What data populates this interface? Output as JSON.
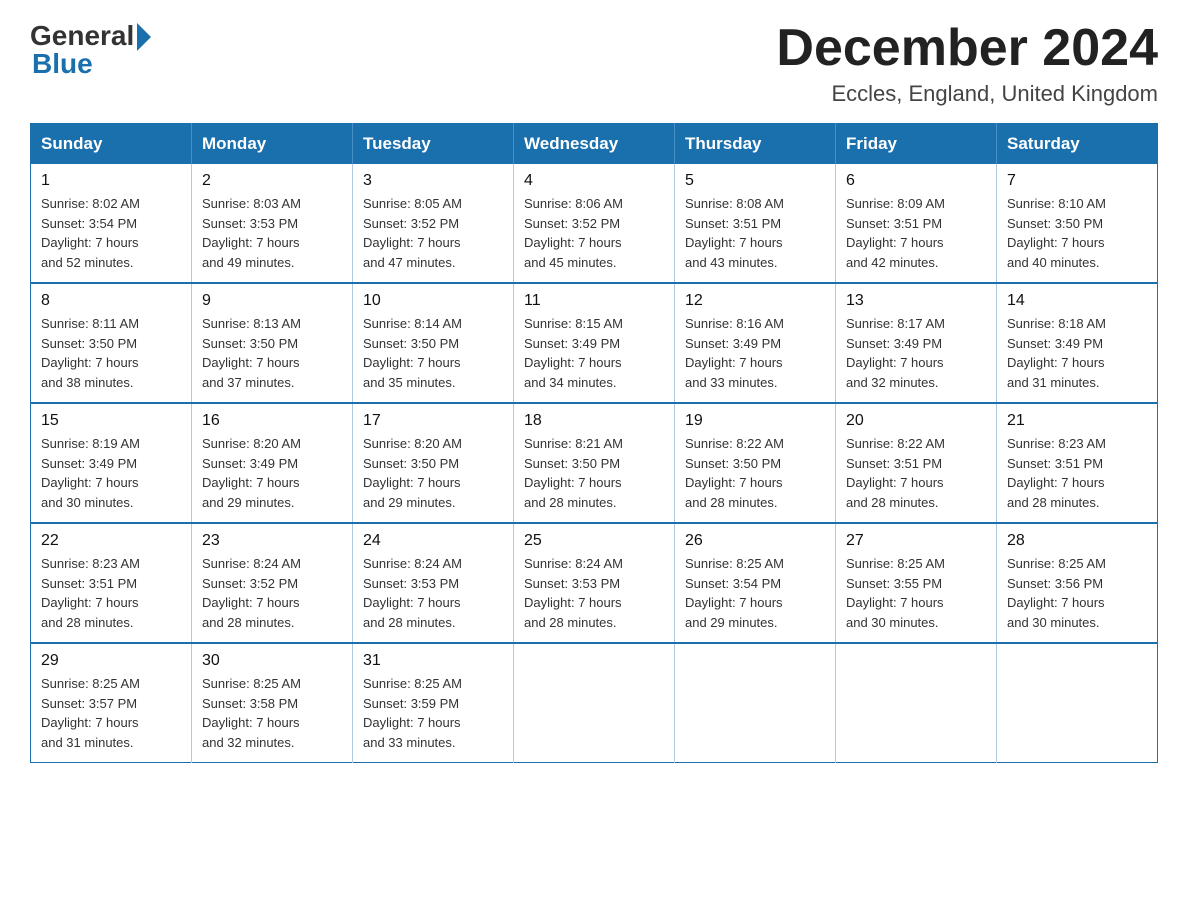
{
  "logo": {
    "general": "General",
    "blue": "Blue"
  },
  "title": "December 2024",
  "location": "Eccles, England, United Kingdom",
  "days_of_week": [
    "Sunday",
    "Monday",
    "Tuesday",
    "Wednesday",
    "Thursday",
    "Friday",
    "Saturday"
  ],
  "weeks": [
    [
      {
        "day": "1",
        "sunrise": "8:02 AM",
        "sunset": "3:54 PM",
        "daylight": "7 hours and 52 minutes."
      },
      {
        "day": "2",
        "sunrise": "8:03 AM",
        "sunset": "3:53 PM",
        "daylight": "7 hours and 49 minutes."
      },
      {
        "day": "3",
        "sunrise": "8:05 AM",
        "sunset": "3:52 PM",
        "daylight": "7 hours and 47 minutes."
      },
      {
        "day": "4",
        "sunrise": "8:06 AM",
        "sunset": "3:52 PM",
        "daylight": "7 hours and 45 minutes."
      },
      {
        "day": "5",
        "sunrise": "8:08 AM",
        "sunset": "3:51 PM",
        "daylight": "7 hours and 43 minutes."
      },
      {
        "day": "6",
        "sunrise": "8:09 AM",
        "sunset": "3:51 PM",
        "daylight": "7 hours and 42 minutes."
      },
      {
        "day": "7",
        "sunrise": "8:10 AM",
        "sunset": "3:50 PM",
        "daylight": "7 hours and 40 minutes."
      }
    ],
    [
      {
        "day": "8",
        "sunrise": "8:11 AM",
        "sunset": "3:50 PM",
        "daylight": "7 hours and 38 minutes."
      },
      {
        "day": "9",
        "sunrise": "8:13 AM",
        "sunset": "3:50 PM",
        "daylight": "7 hours and 37 minutes."
      },
      {
        "day": "10",
        "sunrise": "8:14 AM",
        "sunset": "3:50 PM",
        "daylight": "7 hours and 35 minutes."
      },
      {
        "day": "11",
        "sunrise": "8:15 AM",
        "sunset": "3:49 PM",
        "daylight": "7 hours and 34 minutes."
      },
      {
        "day": "12",
        "sunrise": "8:16 AM",
        "sunset": "3:49 PM",
        "daylight": "7 hours and 33 minutes."
      },
      {
        "day": "13",
        "sunrise": "8:17 AM",
        "sunset": "3:49 PM",
        "daylight": "7 hours and 32 minutes."
      },
      {
        "day": "14",
        "sunrise": "8:18 AM",
        "sunset": "3:49 PM",
        "daylight": "7 hours and 31 minutes."
      }
    ],
    [
      {
        "day": "15",
        "sunrise": "8:19 AM",
        "sunset": "3:49 PM",
        "daylight": "7 hours and 30 minutes."
      },
      {
        "day": "16",
        "sunrise": "8:20 AM",
        "sunset": "3:49 PM",
        "daylight": "7 hours and 29 minutes."
      },
      {
        "day": "17",
        "sunrise": "8:20 AM",
        "sunset": "3:50 PM",
        "daylight": "7 hours and 29 minutes."
      },
      {
        "day": "18",
        "sunrise": "8:21 AM",
        "sunset": "3:50 PM",
        "daylight": "7 hours and 28 minutes."
      },
      {
        "day": "19",
        "sunrise": "8:22 AM",
        "sunset": "3:50 PM",
        "daylight": "7 hours and 28 minutes."
      },
      {
        "day": "20",
        "sunrise": "8:22 AM",
        "sunset": "3:51 PM",
        "daylight": "7 hours and 28 minutes."
      },
      {
        "day": "21",
        "sunrise": "8:23 AM",
        "sunset": "3:51 PM",
        "daylight": "7 hours and 28 minutes."
      }
    ],
    [
      {
        "day": "22",
        "sunrise": "8:23 AM",
        "sunset": "3:51 PM",
        "daylight": "7 hours and 28 minutes."
      },
      {
        "day": "23",
        "sunrise": "8:24 AM",
        "sunset": "3:52 PM",
        "daylight": "7 hours and 28 minutes."
      },
      {
        "day": "24",
        "sunrise": "8:24 AM",
        "sunset": "3:53 PM",
        "daylight": "7 hours and 28 minutes."
      },
      {
        "day": "25",
        "sunrise": "8:24 AM",
        "sunset": "3:53 PM",
        "daylight": "7 hours and 28 minutes."
      },
      {
        "day": "26",
        "sunrise": "8:25 AM",
        "sunset": "3:54 PM",
        "daylight": "7 hours and 29 minutes."
      },
      {
        "day": "27",
        "sunrise": "8:25 AM",
        "sunset": "3:55 PM",
        "daylight": "7 hours and 30 minutes."
      },
      {
        "day": "28",
        "sunrise": "8:25 AM",
        "sunset": "3:56 PM",
        "daylight": "7 hours and 30 minutes."
      }
    ],
    [
      {
        "day": "29",
        "sunrise": "8:25 AM",
        "sunset": "3:57 PM",
        "daylight": "7 hours and 31 minutes."
      },
      {
        "day": "30",
        "sunrise": "8:25 AM",
        "sunset": "3:58 PM",
        "daylight": "7 hours and 32 minutes."
      },
      {
        "day": "31",
        "sunrise": "8:25 AM",
        "sunset": "3:59 PM",
        "daylight": "7 hours and 33 minutes."
      },
      null,
      null,
      null,
      null
    ]
  ],
  "labels": {
    "sunrise": "Sunrise:",
    "sunset": "Sunset:",
    "daylight": "Daylight:"
  }
}
